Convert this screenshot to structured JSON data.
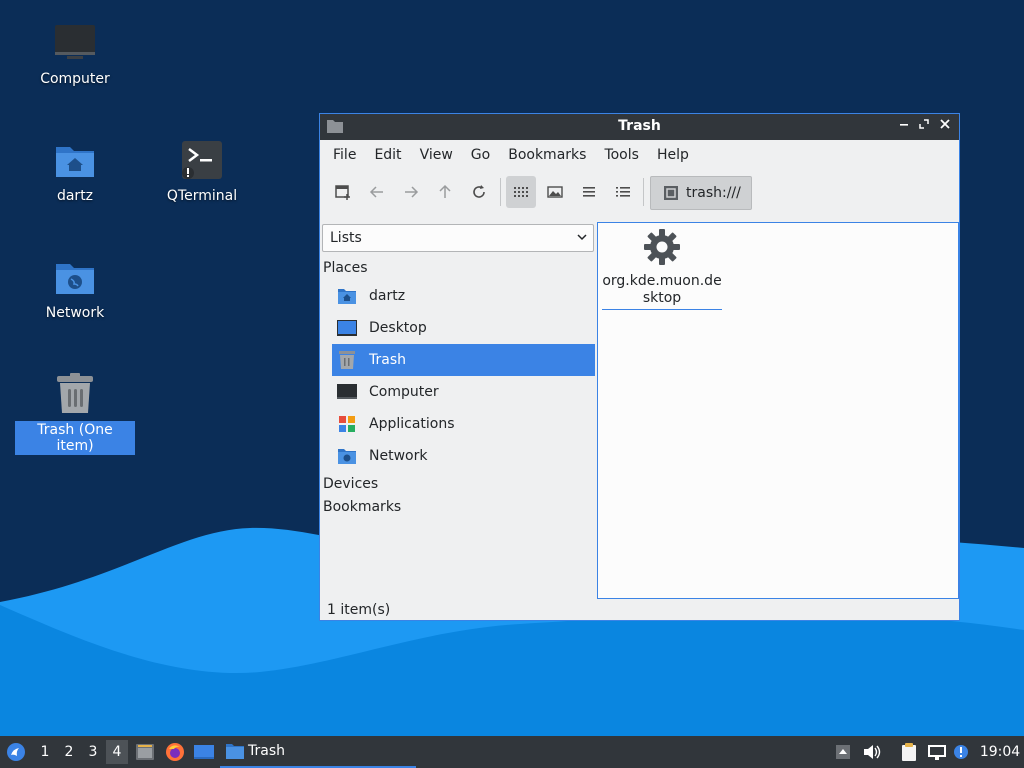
{
  "desktop": {
    "icons": [
      {
        "label": "Computer"
      },
      {
        "label": "dartz"
      },
      {
        "label": "QTerminal"
      },
      {
        "label": "Network"
      },
      {
        "label": "Trash (One item)"
      }
    ]
  },
  "window": {
    "title": "Trash",
    "menu": [
      "File",
      "Edit",
      "View",
      "Go",
      "Bookmarks",
      "Tools",
      "Help"
    ],
    "path": "trash:///",
    "side_pane": {
      "mode": "Lists",
      "sections": {
        "places": "Places",
        "devices": "Devices",
        "bookmarks": "Bookmarks"
      },
      "places": [
        {
          "label": "dartz"
        },
        {
          "label": "Desktop"
        },
        {
          "label": "Trash",
          "selected": true
        },
        {
          "label": "Computer"
        },
        {
          "label": "Applications"
        },
        {
          "label": "Network"
        }
      ]
    },
    "files": [
      {
        "name": "org.kde.muon.desktop",
        "icon": "gear-icon"
      }
    ],
    "status": "1 item(s)"
  },
  "taskbar": {
    "workspaces": [
      "1",
      "2",
      "3",
      "4"
    ],
    "active_workspace": "4",
    "task_label": "Trash",
    "clock": "19:04"
  },
  "colors": {
    "accent": "#3b83e5",
    "desktop_bg": "#0b2d57",
    "panel": "#31363b",
    "window_bg": "#eff0f1"
  }
}
